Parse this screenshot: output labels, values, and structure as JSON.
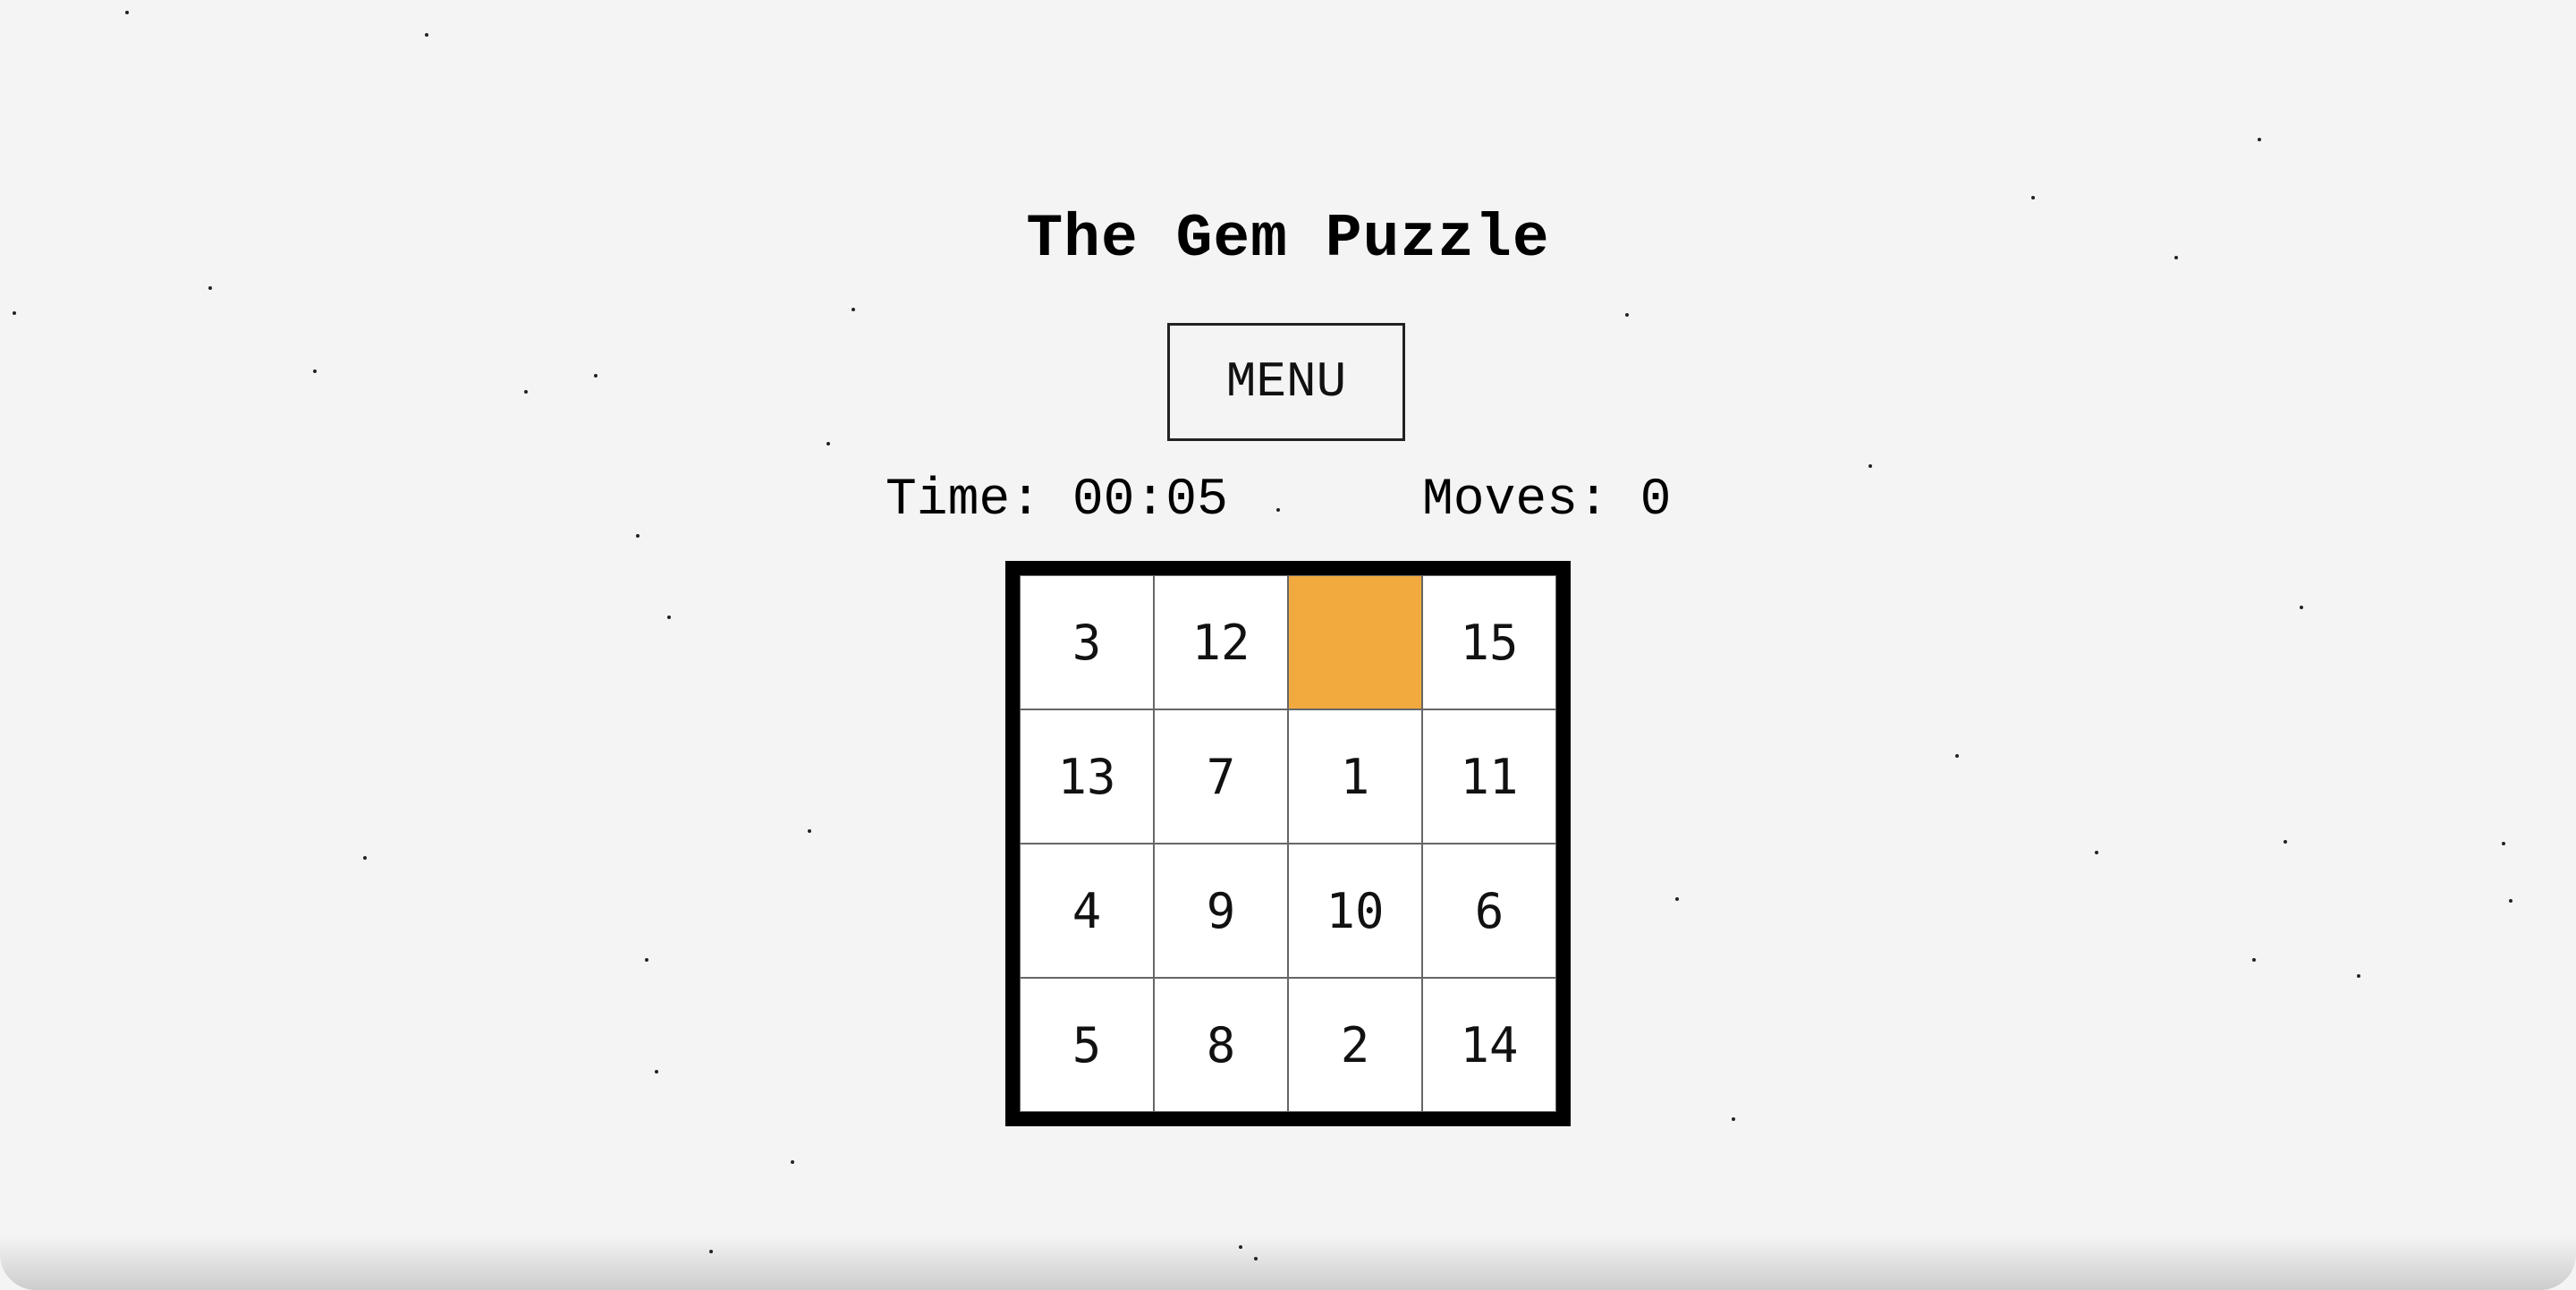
{
  "title": "The Gem Puzzle",
  "menu_label": "MENU",
  "stats": {
    "time_label": "Time:",
    "time_value": "00:05",
    "moves_label": "Moves:",
    "moves_value": "0"
  },
  "board": {
    "tiles": [
      "3",
      "12",
      "",
      "15",
      "13",
      "7",
      "1",
      "11",
      "4",
      "9",
      "10",
      "6",
      "5",
      "8",
      "2",
      "14"
    ],
    "empty_color": "#f2aa3f"
  }
}
